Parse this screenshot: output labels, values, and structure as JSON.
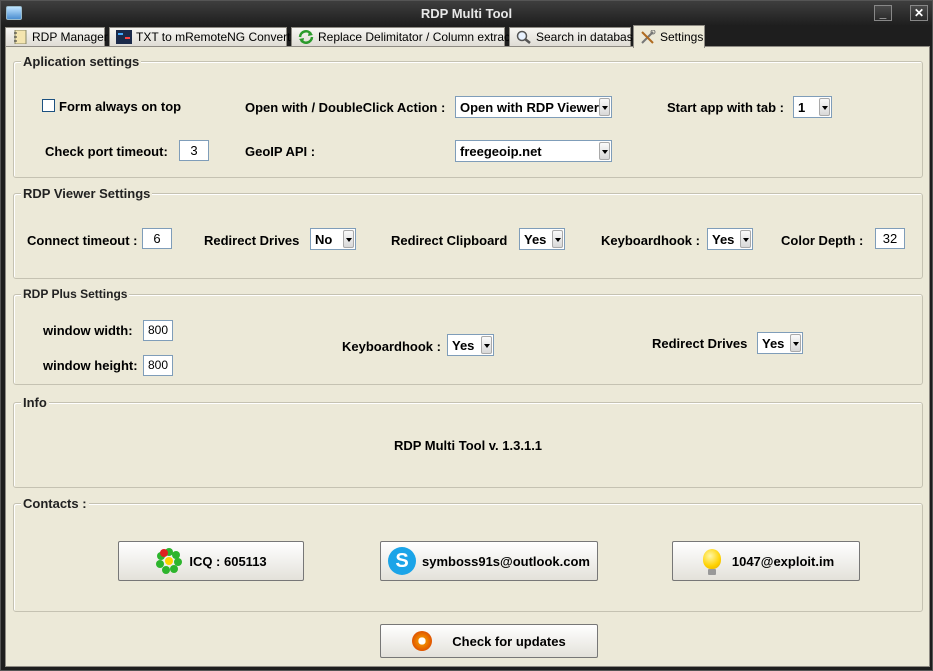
{
  "window": {
    "title": "RDP Multi Tool",
    "minimize": "_",
    "close": "✕"
  },
  "tabs": [
    {
      "label": "RDP Manager",
      "icon": "notebook-icon"
    },
    {
      "label": "TXT to mRemoteNG Converter",
      "icon": "mremoteng-icon"
    },
    {
      "label": "Replace Delimitator / Column extractor",
      "icon": "refresh-arrows-icon"
    },
    {
      "label": "Search in database",
      "icon": "magnifier-icon"
    },
    {
      "label": "Settings",
      "icon": "tools-icon",
      "active": true
    }
  ],
  "app_settings": {
    "legend": "Aplication settings",
    "form_on_top_label": "Form always on top",
    "form_on_top_checked": false,
    "open_with_label": "Open with / DoubleClick Action :",
    "open_with_value": "Open with RDP Viewer",
    "start_tab_label": "Start app with tab :",
    "start_tab_value": "1",
    "port_timeout_label": "Check port timeout:",
    "port_timeout_value": "3",
    "geoip_label": "GeoIP API :",
    "geoip_value": "freegeoip.net"
  },
  "rdp_viewer": {
    "legend": "RDP Viewer Settings",
    "connect_timeout_label": "Connect timeout :",
    "connect_timeout_value": "6",
    "redirect_drives_label": "Redirect Drives",
    "redirect_drives_value": "No",
    "redirect_clipboard_label": "Redirect Clipboard",
    "redirect_clipboard_value": "Yes",
    "keyboardhook_label": "Keyboardhook :",
    "keyboardhook_value": "Yes",
    "color_depth_label": "Color Depth :",
    "color_depth_value": "32"
  },
  "rdp_plus": {
    "legend": "RDP Plus Settings",
    "width_label": "window width:",
    "width_value": "800",
    "height_label": "window height:",
    "height_value": "800",
    "keyboardhook_label": "Keyboardhook :",
    "keyboardhook_value": "Yes",
    "redirect_drives_label": "Redirect Drives",
    "redirect_drives_value": "Yes"
  },
  "info": {
    "legend": "Info",
    "version_text": "RDP Multi Tool v. 1.3.1.1"
  },
  "contacts": {
    "legend": "Contacts :",
    "icq_label": "ICQ : 605113",
    "skype_label": "symboss91s@outlook.com",
    "jabber_label": "1047@exploit.im"
  },
  "updates_button": "Check for updates"
}
